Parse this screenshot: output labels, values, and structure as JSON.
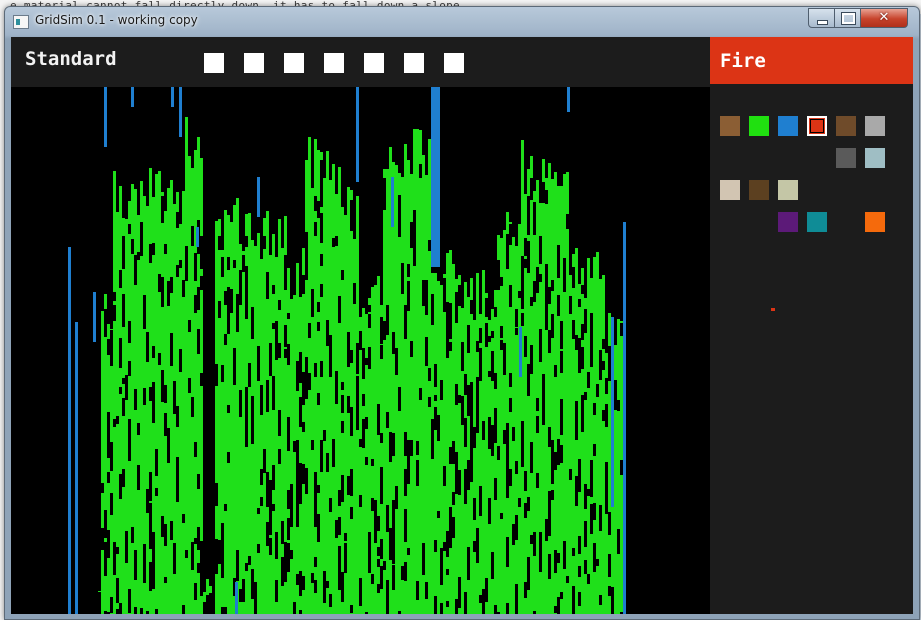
{
  "background_app": {
    "top_line": "e material cannot fall directly down, it has to fall down a slope."
  },
  "window": {
    "title": "GridSim 0.1 - working copy",
    "controls": {
      "minimize": "",
      "maximize": "",
      "close": "✕"
    }
  },
  "header": {
    "mode_title": "Standard",
    "slot_count": 7,
    "slot_color": "#ffffff"
  },
  "panel": {
    "selected_material": "Fire",
    "selected_color": "#dc3415",
    "cursor_color": "#dc3415",
    "swatches": [
      {
        "color": "#8b5e34",
        "row": 0,
        "col": 0,
        "selected": false
      },
      {
        "color": "#20e010",
        "row": 0,
        "col": 1,
        "selected": false
      },
      {
        "color": "#1f7fd0",
        "row": 0,
        "col": 2,
        "selected": false
      },
      {
        "color": "#dc3415",
        "row": 0,
        "col": 3,
        "selected": true
      },
      {
        "color": "#6f4b2a",
        "row": 0,
        "col": 4,
        "selected": false
      },
      {
        "color": "#a9a9a9",
        "row": 0,
        "col": 5,
        "selected": false
      },
      {
        "color": "#5a5a5a",
        "row": 1,
        "col": 4,
        "selected": false
      },
      {
        "color": "#9fbec4",
        "row": 1,
        "col": 5,
        "selected": false
      },
      {
        "color": "#d2c5b2",
        "row": 2,
        "col": 0,
        "selected": false
      },
      {
        "color": "#5c4020",
        "row": 2,
        "col": 1,
        "selected": false
      },
      {
        "color": "#c4c6a6",
        "row": 2,
        "col": 2,
        "selected": false
      },
      {
        "color": "#5c1a78",
        "row": 3,
        "col": 2,
        "selected": false
      },
      {
        "color": "#0f8c96",
        "row": 3,
        "col": 3,
        "selected": false
      },
      {
        "color": "#f56a0c",
        "row": 3,
        "col": 5,
        "selected": false
      }
    ]
  },
  "simulation": {
    "grid_cols": 233,
    "plant_color": "#1fe01a",
    "water_color": "#1f7fd0",
    "empty_color": "#000000"
  }
}
